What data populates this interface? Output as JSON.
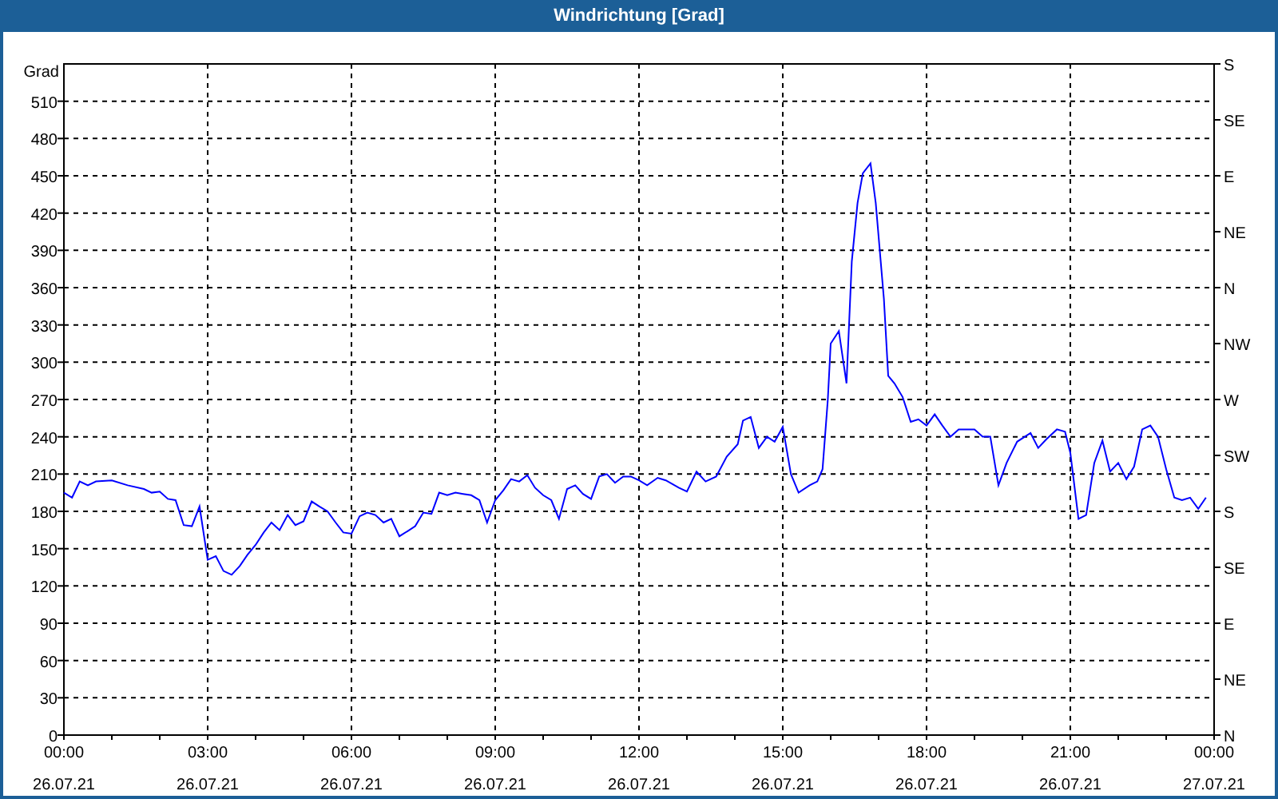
{
  "window": {
    "title": "Windrichtung [Grad]"
  },
  "chart": {
    "x_dates": [
      "26.07.21",
      "26.07.21",
      "26.07.21",
      "26.07.21",
      "26.07.21",
      "26.07.21",
      "26.07.21",
      "26.07.21",
      "27.07.21"
    ],
    "compass_ticks": [
      "S",
      "SE",
      "E",
      "NE",
      "N",
      "NW",
      "W",
      "SW",
      "S",
      "SE",
      "E",
      "NE",
      "N"
    ],
    "chart_data": {
      "type": "line",
      "grid": true,
      "ylabel": "Grad",
      "xlim": [
        0,
        24
      ],
      "ylim": [
        0,
        540
      ],
      "xticks": [
        {
          "value": 0,
          "label": "00:00"
        },
        {
          "value": 3,
          "label": "03:00"
        },
        {
          "value": 6,
          "label": "06:00"
        },
        {
          "value": 9,
          "label": "09:00"
        },
        {
          "value": 12,
          "label": "12:00"
        },
        {
          "value": 15,
          "label": "15:00"
        },
        {
          "value": 18,
          "label": "18:00"
        },
        {
          "value": 21,
          "label": "21:00"
        },
        {
          "value": 24,
          "label": "00:00"
        }
      ],
      "yticks": [
        0,
        30,
        60,
        90,
        120,
        150,
        180,
        210,
        240,
        270,
        300,
        330,
        360,
        390,
        420,
        450,
        480,
        510
      ],
      "x": [
        0,
        0.17,
        0.33,
        0.5,
        0.67,
        1,
        1.33,
        1.67,
        1.83,
        2,
        2.17,
        2.33,
        2.5,
        2.67,
        2.83,
        3,
        3.17,
        3.33,
        3.5,
        3.67,
        3.83,
        4,
        4.17,
        4.33,
        4.5,
        4.67,
        4.83,
        5,
        5.17,
        5.33,
        5.5,
        5.67,
        5.83,
        6,
        6.17,
        6.33,
        6.5,
        6.67,
        6.83,
        7,
        7.17,
        7.33,
        7.5,
        7.67,
        7.83,
        8,
        8.17,
        8.33,
        8.5,
        8.67,
        8.83,
        9,
        9.17,
        9.33,
        9.5,
        9.67,
        9.83,
        10,
        10.17,
        10.33,
        10.5,
        10.67,
        10.83,
        11,
        11.17,
        11.33,
        11.5,
        11.67,
        11.83,
        12,
        12.17,
        12.39,
        12.56,
        12.83,
        13,
        13.2,
        13.39,
        13.61,
        13.83,
        14.06,
        14.17,
        14.33,
        14.5,
        14.67,
        14.83,
        15,
        15.17,
        15.33,
        15.56,
        15.72,
        15.83,
        15.94,
        16,
        16.17,
        16.33,
        16.44,
        16.56,
        16.67,
        16.83,
        16.94,
        17.11,
        17.2,
        17.33,
        17.5,
        17.67,
        17.83,
        18,
        18.17,
        18.33,
        18.5,
        18.67,
        19,
        19.17,
        19.33,
        19.5,
        19.67,
        19.89,
        20.17,
        20.33,
        20.5,
        20.72,
        20.89,
        21,
        21.17,
        21.33,
        21.5,
        21.67,
        21.83,
        22,
        22.17,
        22.33,
        22.5,
        22.67,
        22.83,
        23,
        23.17,
        23.33,
        23.5,
        23.67,
        23.83
      ],
      "series": [
        {
          "color": "#0000ff",
          "values": [
            195,
            191,
            204,
            201,
            204,
            205,
            201,
            198,
            195,
            196,
            190,
            189,
            169,
            168,
            184,
            141,
            144,
            132,
            129,
            136,
            145,
            153,
            163,
            171,
            165,
            177,
            169,
            172,
            188,
            184,
            180,
            171,
            163,
            162,
            176,
            179,
            177,
            171,
            174,
            160,
            164,
            168,
            179,
            178,
            195,
            193,
            195,
            194,
            193,
            189,
            171,
            189,
            197,
            206,
            204,
            209,
            199,
            193,
            189,
            174,
            198,
            201,
            194,
            190,
            208,
            210,
            203,
            208,
            208,
            205,
            201,
            207,
            205,
            199,
            196,
            212,
            204,
            208,
            224,
            234,
            253,
            256,
            231,
            240,
            236,
            248,
            210,
            195,
            201,
            204,
            214,
            270,
            315,
            325,
            283,
            381,
            428,
            452,
            460,
            428,
            351,
            289,
            283,
            272,
            252,
            254,
            249,
            258,
            249,
            240,
            246,
            246,
            240,
            240,
            201,
            219,
            236,
            243,
            231,
            238,
            246,
            244,
            227,
            174,
            177,
            219,
            237,
            212,
            219,
            206,
            216,
            246,
            249,
            240,
            214,
            191,
            189,
            191,
            182,
            191
          ]
        }
      ]
    }
  }
}
